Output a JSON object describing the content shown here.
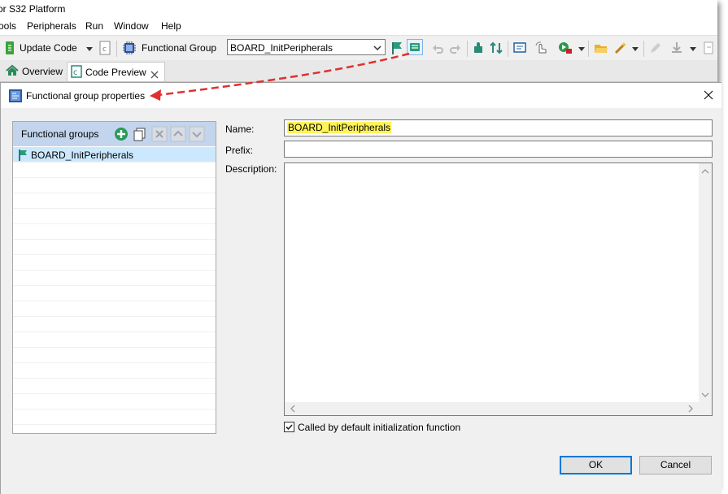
{
  "window": {
    "title": "or S32 Platform"
  },
  "menu": [
    "ools",
    "Peripherals",
    "Run",
    "Window",
    "Help"
  ],
  "toolbar": {
    "update_code": "Update Code",
    "functional_group_label": "Functional Group",
    "functional_group_value": "BOARD_InitPeripherals"
  },
  "tabs": [
    {
      "label": "Overview"
    },
    {
      "label": "Code Preview"
    }
  ],
  "dialog": {
    "title": "Functional group properties",
    "groups_header": "Functional groups",
    "groups": [
      "BOARD_InitPeripherals"
    ],
    "name_label": "Name:",
    "name_value": "BOARD_InitPeripherals",
    "prefix_label": "Prefix:",
    "prefix_value": "",
    "description_label": "Description:",
    "description_value": "",
    "checkbox_label": "Called by default initialization function",
    "checkbox_checked": true,
    "ok_label": "OK",
    "cancel_label": "Cancel"
  },
  "colors": {
    "accent": "#0078d7",
    "highlight": "#fff35a",
    "annotation_arrow": "#e03030",
    "list_header": "#c3d5ec",
    "selection": "#cce8ff"
  }
}
